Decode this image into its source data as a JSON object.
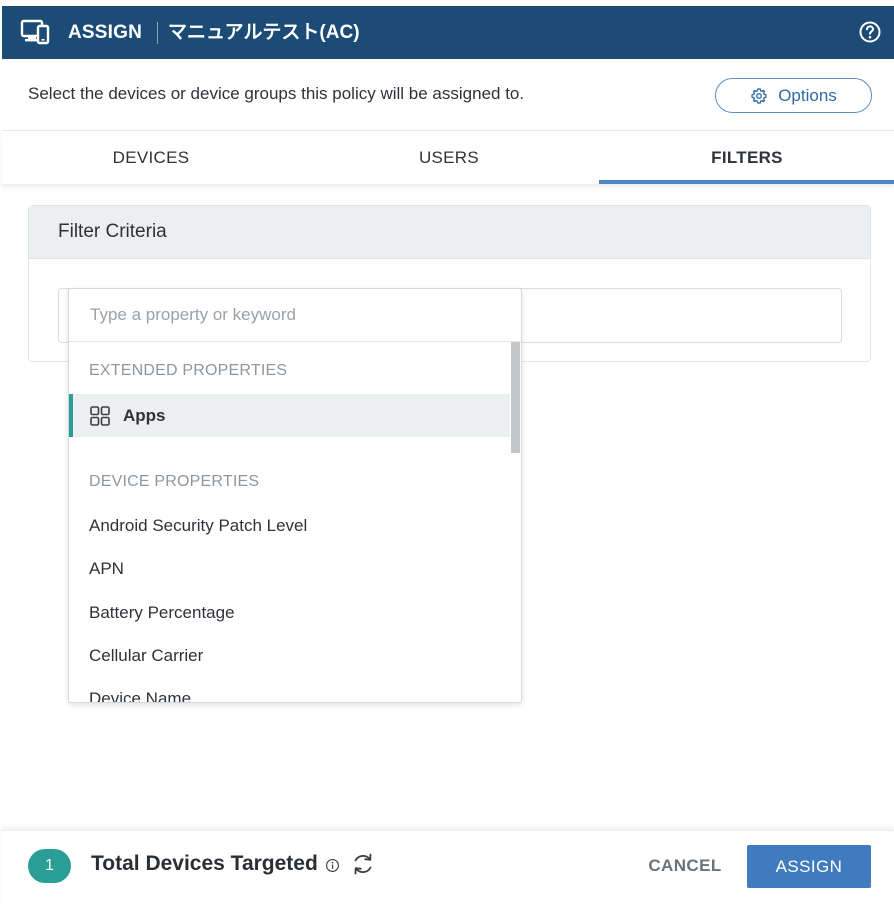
{
  "header": {
    "title": "ASSIGN",
    "subtitle": "マニュアルテスト(AC)",
    "icons": {
      "app": "device-assign-icon",
      "help": "help-icon"
    }
  },
  "description": "Select the devices or device groups this policy will be assigned to.",
  "options_button": {
    "label": "Options",
    "icon": "gear-icon"
  },
  "tabs": [
    {
      "label": "DEVICES",
      "active": false
    },
    {
      "label": "USERS",
      "active": false
    },
    {
      "label": "FILTERS",
      "active": true
    }
  ],
  "filter_panel": {
    "title": "Filter Criteria"
  },
  "dropdown": {
    "search_placeholder": "Type a property or keyword",
    "sections": [
      {
        "title": "EXTENDED PROPERTIES",
        "items": [
          {
            "label": "Apps",
            "icon": "apps-grid-icon",
            "selected": true
          }
        ]
      },
      {
        "title": "DEVICE PROPERTIES",
        "items": [
          {
            "label": "Android Security Patch Level"
          },
          {
            "label": "APN"
          },
          {
            "label": "Battery Percentage"
          },
          {
            "label": "Cellular Carrier"
          },
          {
            "label": "Device Name"
          }
        ]
      }
    ]
  },
  "footer": {
    "count": "1",
    "title": "Total Devices Targeted",
    "cancel_label": "CANCEL",
    "assign_label": "ASSIGN"
  },
  "colors": {
    "header_bg": "#1c4b76",
    "accent_blue": "#3f7bbd",
    "teal": "#2a9d96"
  }
}
